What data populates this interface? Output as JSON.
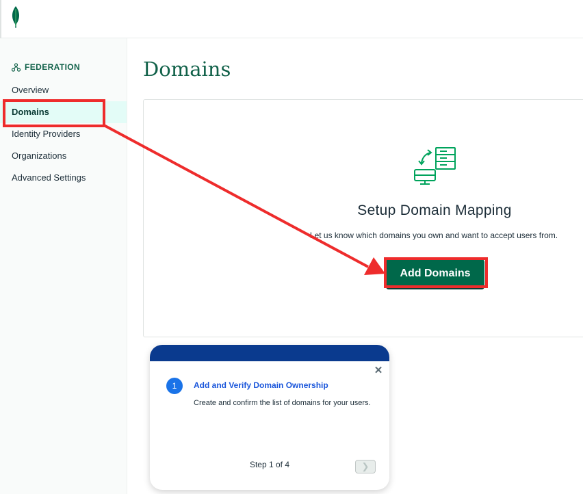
{
  "brand": {
    "logo": "mongodb-leaf-logo",
    "accent": "#00684a",
    "title_color": "#116149"
  },
  "sidebar": {
    "section_title": "FEDERATION",
    "section_icon": "federation-icon",
    "items": [
      {
        "label": "Overview",
        "active": false
      },
      {
        "label": "Domains",
        "active": true
      },
      {
        "label": "Identity Providers",
        "active": false
      },
      {
        "label": "Organizations",
        "active": false
      },
      {
        "label": "Advanced Settings",
        "active": false
      }
    ]
  },
  "main": {
    "title": "Domains",
    "empty_state": {
      "icon": "server-sync-icon",
      "title": "Setup Domain Mapping",
      "description": "Let us know which domains you own and want to accept users from.",
      "button_label": "Add Domains"
    }
  },
  "guide": {
    "step_number": "1",
    "title": "Add and Verify Domain Ownership",
    "body": "Create and confirm the list of domains for your users.",
    "step_label": "Step 1 of 4",
    "band_color": "#0a3a8e"
  },
  "annotation": {
    "color": "#ee2c2c"
  }
}
